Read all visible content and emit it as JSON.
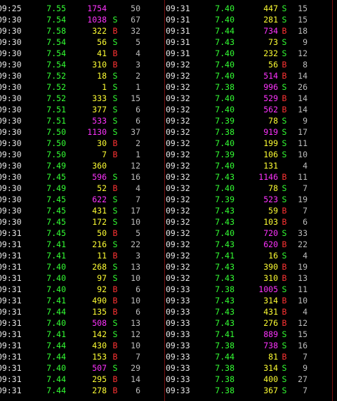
{
  "colors": {
    "background": "#000000",
    "time": "#e6e6e6",
    "price": "#33ff33",
    "volume_normal": "#ffff33",
    "volume_large": "#ff33ff",
    "sell": "#33ff33",
    "buy": "#ff3333",
    "count": "#bdbdbd",
    "divider": "#7a1010"
  },
  "left": [
    {
      "time": "09:25",
      "price": "7.55",
      "volume": "1754",
      "flag": "",
      "count": "50",
      "big": true
    },
    {
      "time": "09:30",
      "price": "7.54",
      "volume": "1038",
      "flag": "S",
      "count": "67",
      "big": true
    },
    {
      "time": "09:30",
      "price": "7.58",
      "volume": "322",
      "flag": "B",
      "count": "32",
      "big": false
    },
    {
      "time": "09:30",
      "price": "7.54",
      "volume": "56",
      "flag": "S",
      "count": "5",
      "big": false
    },
    {
      "time": "09:30",
      "price": "7.54",
      "volume": "41",
      "flag": "B",
      "count": "4",
      "big": false
    },
    {
      "time": "09:30",
      "price": "7.54",
      "volume": "310",
      "flag": "B",
      "count": "3",
      "big": false
    },
    {
      "time": "09:30",
      "price": "7.52",
      "volume": "18",
      "flag": "S",
      "count": "2",
      "big": false
    },
    {
      "time": "09:30",
      "price": "7.52",
      "volume": "1",
      "flag": "S",
      "count": "1",
      "big": false
    },
    {
      "time": "09:30",
      "price": "7.52",
      "volume": "333",
      "flag": "S",
      "count": "15",
      "big": false
    },
    {
      "time": "09:30",
      "price": "7.51",
      "volume": "377",
      "flag": "S",
      "count": "6",
      "big": false
    },
    {
      "time": "09:30",
      "price": "7.51",
      "volume": "533",
      "flag": "S",
      "count": "6",
      "big": true
    },
    {
      "time": "09:30",
      "price": "7.50",
      "volume": "1130",
      "flag": "S",
      "count": "37",
      "big": true
    },
    {
      "time": "09:30",
      "price": "7.50",
      "volume": "30",
      "flag": "B",
      "count": "2",
      "big": false
    },
    {
      "time": "09:30",
      "price": "7.50",
      "volume": "7",
      "flag": "B",
      "count": "1",
      "big": false
    },
    {
      "time": "09:30",
      "price": "7.49",
      "volume": "360",
      "flag": "",
      "count": "12",
      "big": false
    },
    {
      "time": "09:30",
      "price": "7.45",
      "volume": "596",
      "flag": "S",
      "count": "16",
      "big": true
    },
    {
      "time": "09:30",
      "price": "7.49",
      "volume": "52",
      "flag": "B",
      "count": "4",
      "big": false
    },
    {
      "time": "09:30",
      "price": "7.45",
      "volume": "622",
      "flag": "S",
      "count": "7",
      "big": true
    },
    {
      "time": "09:30",
      "price": "7.45",
      "volume": "431",
      "flag": "S",
      "count": "17",
      "big": false
    },
    {
      "time": "09:30",
      "price": "7.45",
      "volume": "172",
      "flag": "S",
      "count": "10",
      "big": false
    },
    {
      "time": "09:31",
      "price": "7.45",
      "volume": "50",
      "flag": "B",
      "count": "5",
      "big": false
    },
    {
      "time": "09:31",
      "price": "7.41",
      "volume": "216",
      "flag": "S",
      "count": "22",
      "big": false
    },
    {
      "time": "09:31",
      "price": "7.41",
      "volume": "11",
      "flag": "B",
      "count": "3",
      "big": false
    },
    {
      "time": "09:31",
      "price": "7.40",
      "volume": "268",
      "flag": "S",
      "count": "13",
      "big": false
    },
    {
      "time": "09:31",
      "price": "7.40",
      "volume": "97",
      "flag": "S",
      "count": "10",
      "big": false
    },
    {
      "time": "09:31",
      "price": "7.40",
      "volume": "92",
      "flag": "B",
      "count": "6",
      "big": false
    },
    {
      "time": "09:31",
      "price": "7.41",
      "volume": "490",
      "flag": "B",
      "count": "10",
      "big": false
    },
    {
      "time": "09:31",
      "price": "7.44",
      "volume": "135",
      "flag": "B",
      "count": "6",
      "big": false
    },
    {
      "time": "09:31",
      "price": "7.40",
      "volume": "508",
      "flag": "S",
      "count": "13",
      "big": true
    },
    {
      "time": "09:31",
      "price": "7.41",
      "volume": "142",
      "flag": "S",
      "count": "12",
      "big": false
    },
    {
      "time": "09:31",
      "price": "7.44",
      "volume": "430",
      "flag": "B",
      "count": "10",
      "big": false
    },
    {
      "time": "09:31",
      "price": "7.44",
      "volume": "153",
      "flag": "B",
      "count": "7",
      "big": false
    },
    {
      "time": "09:31",
      "price": "7.40",
      "volume": "507",
      "flag": "S",
      "count": "29",
      "big": true
    },
    {
      "time": "09:31",
      "price": "7.44",
      "volume": "295",
      "flag": "B",
      "count": "14",
      "big": false
    },
    {
      "time": "09:31",
      "price": "7.44",
      "volume": "278",
      "flag": "B",
      "count": "6",
      "big": false
    }
  ],
  "right": [
    {
      "time": "09:31",
      "price": "7.40",
      "volume": "447",
      "flag": "S",
      "count": "15",
      "big": false
    },
    {
      "time": "09:31",
      "price": "7.40",
      "volume": "281",
      "flag": "S",
      "count": "15",
      "big": false
    },
    {
      "time": "09:31",
      "price": "7.44",
      "volume": "734",
      "flag": "B",
      "count": "18",
      "big": true
    },
    {
      "time": "09:31",
      "price": "7.43",
      "volume": "73",
      "flag": "S",
      "count": "9",
      "big": false
    },
    {
      "time": "09:31",
      "price": "7.40",
      "volume": "232",
      "flag": "S",
      "count": "12",
      "big": false
    },
    {
      "time": "09:32",
      "price": "7.40",
      "volume": "56",
      "flag": "B",
      "count": "8",
      "big": false
    },
    {
      "time": "09:32",
      "price": "7.40",
      "volume": "514",
      "flag": "B",
      "count": "14",
      "big": true
    },
    {
      "time": "09:32",
      "price": "7.38",
      "volume": "996",
      "flag": "S",
      "count": "26",
      "big": true
    },
    {
      "time": "09:32",
      "price": "7.40",
      "volume": "529",
      "flag": "B",
      "count": "14",
      "big": true
    },
    {
      "time": "09:32",
      "price": "7.40",
      "volume": "562",
      "flag": "B",
      "count": "14",
      "big": true
    },
    {
      "time": "09:32",
      "price": "7.39",
      "volume": "78",
      "flag": "S",
      "count": "9",
      "big": false
    },
    {
      "time": "09:32",
      "price": "7.38",
      "volume": "919",
      "flag": "S",
      "count": "17",
      "big": true
    },
    {
      "time": "09:32",
      "price": "7.40",
      "volume": "199",
      "flag": "S",
      "count": "11",
      "big": false
    },
    {
      "time": "09:32",
      "price": "7.39",
      "volume": "106",
      "flag": "S",
      "count": "10",
      "big": false
    },
    {
      "time": "09:32",
      "price": "7.40",
      "volume": "131",
      "flag": "",
      "count": "4",
      "big": false
    },
    {
      "time": "09:32",
      "price": "7.43",
      "volume": "1146",
      "flag": "B",
      "count": "11",
      "big": true
    },
    {
      "time": "09:32",
      "price": "7.40",
      "volume": "78",
      "flag": "S",
      "count": "7",
      "big": false
    },
    {
      "time": "09:32",
      "price": "7.39",
      "volume": "523",
      "flag": "S",
      "count": "19",
      "big": true
    },
    {
      "time": "09:32",
      "price": "7.43",
      "volume": "59",
      "flag": "B",
      "count": "7",
      "big": false
    },
    {
      "time": "09:32",
      "price": "7.43",
      "volume": "103",
      "flag": "B",
      "count": "6",
      "big": false
    },
    {
      "time": "09:32",
      "price": "7.40",
      "volume": "720",
      "flag": "S",
      "count": "33",
      "big": true
    },
    {
      "time": "09:32",
      "price": "7.43",
      "volume": "620",
      "flag": "B",
      "count": "22",
      "big": true
    },
    {
      "time": "09:32",
      "price": "7.41",
      "volume": "16",
      "flag": "S",
      "count": "4",
      "big": false
    },
    {
      "time": "09:32",
      "price": "7.43",
      "volume": "390",
      "flag": "B",
      "count": "19",
      "big": false
    },
    {
      "time": "09:32",
      "price": "7.43",
      "volume": "310",
      "flag": "B",
      "count": "13",
      "big": false
    },
    {
      "time": "09:33",
      "price": "7.38",
      "volume": "1005",
      "flag": "S",
      "count": "11",
      "big": true
    },
    {
      "time": "09:33",
      "price": "7.43",
      "volume": "314",
      "flag": "B",
      "count": "10",
      "big": false
    },
    {
      "time": "09:33",
      "price": "7.43",
      "volume": "431",
      "flag": "B",
      "count": "4",
      "big": false
    },
    {
      "time": "09:33",
      "price": "7.43",
      "volume": "276",
      "flag": "B",
      "count": "12",
      "big": false
    },
    {
      "time": "09:33",
      "price": "7.41",
      "volume": "889",
      "flag": "S",
      "count": "15",
      "big": true
    },
    {
      "time": "09:33",
      "price": "7.38",
      "volume": "738",
      "flag": "S",
      "count": "16",
      "big": true
    },
    {
      "time": "09:33",
      "price": "7.44",
      "volume": "81",
      "flag": "B",
      "count": "7",
      "big": false
    },
    {
      "time": "09:33",
      "price": "7.38",
      "volume": "314",
      "flag": "S",
      "count": "9",
      "big": false
    },
    {
      "time": "09:33",
      "price": "7.38",
      "volume": "400",
      "flag": "S",
      "count": "27",
      "big": false
    },
    {
      "time": "09:33",
      "price": "7.38",
      "volume": "367",
      "flag": "S",
      "count": "7",
      "big": false
    }
  ]
}
